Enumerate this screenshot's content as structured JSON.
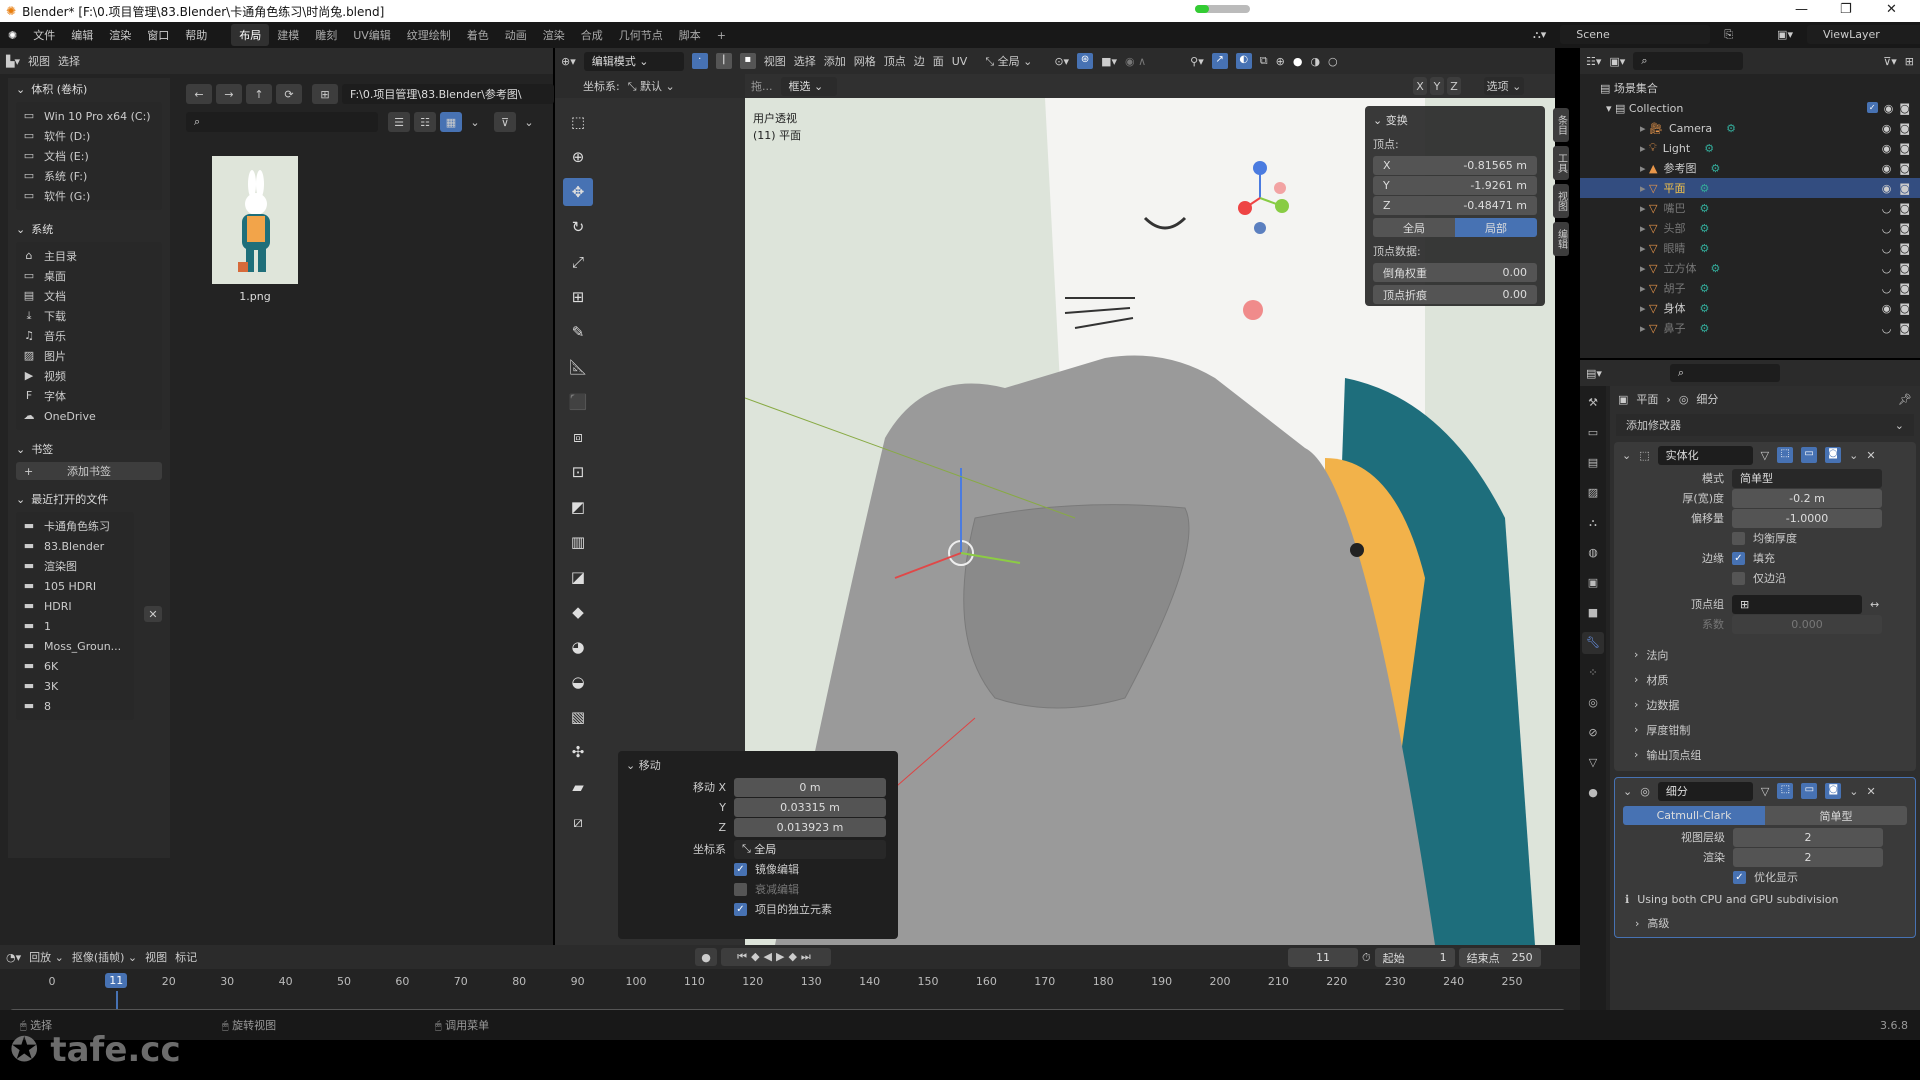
{
  "window": {
    "title": "Blender* [F:\\0.项目管理\\83.Blender\\卡通角色练习\\时尚兔.blend]",
    "controls": [
      "—",
      "❐",
      "✕"
    ]
  },
  "menubar": {
    "menus": [
      "文件",
      "编辑",
      "渲染",
      "窗口",
      "帮助"
    ],
    "workspaces": [
      "布局",
      "建模",
      "雕刻",
      "UV编辑",
      "纹理绘制",
      "着色",
      "动画",
      "渲染",
      "合成",
      "几何节点",
      "脚本"
    ],
    "active_workspace": "布局",
    "add_workspace": "+",
    "scene": "Scene",
    "view_layer": "ViewLayer"
  },
  "file_browser": {
    "header_menus": [
      "视图",
      "选择"
    ],
    "path": "F:\\0.项目管理\\83.Blender\\参考图\\",
    "search_placeholder": "",
    "volumes_title": "体积 (卷标)",
    "volumes": [
      "Win 10 Pro x64 (C:)",
      "软件 (D:)",
      "文档 (E:)",
      "系统 (F:)",
      "软件 (G:)"
    ],
    "system_title": "系统",
    "system": [
      {
        "label": "主目录",
        "icon": "home-icon"
      },
      {
        "label": "桌面",
        "icon": "desktop-icon"
      },
      {
        "label": "文档",
        "icon": "documents-icon"
      },
      {
        "label": "下载",
        "icon": "download-icon"
      },
      {
        "label": "音乐",
        "icon": "music-icon"
      },
      {
        "label": "图片",
        "icon": "image-icon"
      },
      {
        "label": "视频",
        "icon": "video-icon"
      },
      {
        "label": "字体",
        "icon": "font-icon"
      },
      {
        "label": "OneDrive",
        "icon": "cloud-icon"
      }
    ],
    "bookmarks_title": "书签",
    "add_bookmark": "添加书签",
    "recent_title": "最近打开的文件",
    "recent": [
      "卡通角色练习",
      "83.Blender",
      "渲染图",
      "105  HDRI",
      "HDRI",
      "1",
      "Moss_Groun...",
      "6K",
      "3K",
      "8"
    ],
    "files": [
      {
        "name": "1.png"
      }
    ]
  },
  "viewport": {
    "mode": "编辑模式",
    "menus": [
      "视图",
      "选择",
      "添加",
      "网格",
      "顶点",
      "边",
      "面",
      "UV"
    ],
    "transform_orientation": "全局",
    "coord_label": "坐标系:",
    "coord_value": "默认",
    "drag_label": "拖...",
    "select_mode": "框选",
    "axes": [
      "X",
      "Y",
      "Z"
    ],
    "options": "选项",
    "overlay_title": "用户透视",
    "overlay_object": "(11) 平面",
    "side_tabs": [
      "条目",
      "工具",
      "视图",
      "编辑"
    ],
    "transform_panel": {
      "title": "变换",
      "vertex_label": "顶点:",
      "x": "-0.81565 m",
      "y": "-1.9261 m",
      "z": "-0.48471 m",
      "global": "全局",
      "local": "局部",
      "vertex_data_label": "顶点数据:",
      "bevel_weight_label": "倒角权重",
      "bevel_weight": "0.00",
      "crease_label": "顶点折痕",
      "crease": "0.00"
    },
    "move_panel": {
      "title": "移动",
      "x_label": "移动 X",
      "x": "0 m",
      "y_label": "Y",
      "y": "0.03315 m",
      "z_label": "Z",
      "z": "0.013923 m",
      "orient_label": "坐标系",
      "orient": "全局",
      "options": [
        {
          "label": "镜像编辑",
          "checked": true
        },
        {
          "label": "衰减编辑",
          "checked": false
        },
        {
          "label": "项目的独立元素",
          "checked": true
        }
      ]
    }
  },
  "outliner": {
    "root": "场景集合",
    "collection": "Collection",
    "items": [
      {
        "name": "Camera",
        "visible": true,
        "selected": false
      },
      {
        "name": "Light",
        "visible": true,
        "selected": false
      },
      {
        "name": "参考图",
        "visible": true,
        "selected": false
      },
      {
        "name": "平面",
        "visible": true,
        "selected": true
      },
      {
        "name": "嘴巴",
        "visible": false,
        "selected": false
      },
      {
        "name": "头部",
        "visible": false,
        "selected": false
      },
      {
        "name": "眼睛",
        "visible": false,
        "selected": false
      },
      {
        "name": "立方体",
        "visible": false,
        "selected": false
      },
      {
        "name": "胡子",
        "visible": false,
        "selected": false
      },
      {
        "name": "身体",
        "visible": true,
        "selected": false
      },
      {
        "name": "鼻子",
        "visible": false,
        "selected": false
      }
    ]
  },
  "properties": {
    "breadcrumb": [
      "平面",
      "细分"
    ],
    "add_modifier": "添加修改器",
    "solidify": {
      "name": "实体化",
      "mode_label": "模式",
      "mode": "简单型",
      "thickness_label": "厚(宽)度",
      "thickness": "-0.2 m",
      "offset_label": "偏移量",
      "offset": "-1.0000",
      "even_thickness": "均衡厚度",
      "even_thickness_checked": false,
      "rim_label": "边缘",
      "fill": "填充",
      "fill_checked": true,
      "rim_only": "仅边沿",
      "rim_only_checked": false,
      "vgroup_label": "顶点组",
      "factor_label": "系数",
      "factor": "0.000",
      "subpanels": [
        "法向",
        "材质",
        "边数据",
        "厚度钳制",
        "输出顶点组"
      ]
    },
    "subdivision": {
      "name": "细分",
      "types": [
        "Catmull-Clark",
        "简单型"
      ],
      "active_type": "Catmull-Clark",
      "viewport_label": "视图层级",
      "viewport": "2",
      "render_label": "渲染",
      "render": "2",
      "optimal": "优化显示",
      "optimal_checked": true,
      "info": "Using both CPU and GPU subdivision",
      "advanced": "高级"
    }
  },
  "timeline": {
    "menus": [
      "回放",
      "抠像(插帧)",
      "视图",
      "标记"
    ],
    "current_frame": "11",
    "start_label": "起始",
    "start": "1",
    "end_label": "结束点",
    "end": "250",
    "ticks": [
      "0",
      "20",
      "30",
      "40",
      "50",
      "60",
      "70",
      "80",
      "90",
      "100",
      "110",
      "120",
      "130",
      "140",
      "150",
      "160",
      "170",
      "180",
      "190",
      "200",
      "210",
      "220",
      "230",
      "240",
      "250"
    ]
  },
  "statusbar": {
    "items": [
      "选择",
      "旋转视图",
      "调用菜单"
    ],
    "version": "3.6.8"
  },
  "watermark": "tafe.cc",
  "colors": {
    "accent": "#4772b3",
    "selected_row": "#334d80",
    "panel": "#2e2e2e",
    "viewport_bg": "#dde4da"
  }
}
